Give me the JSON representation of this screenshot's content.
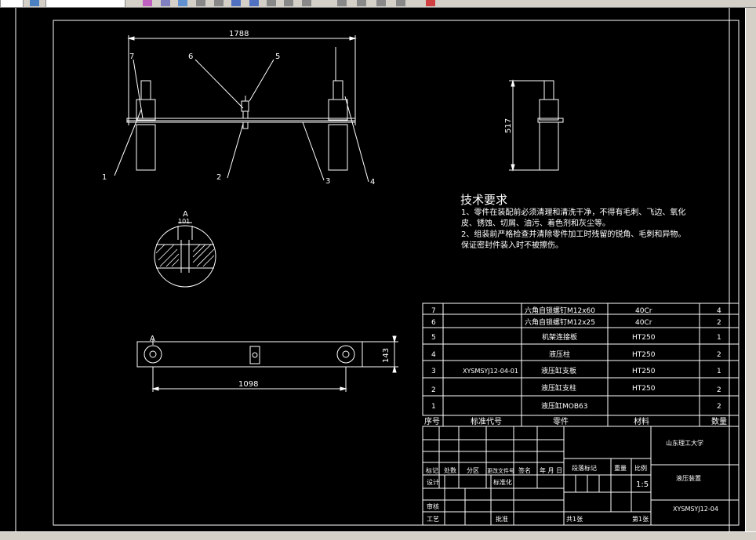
{
  "dimensions": {
    "top_width": "1788",
    "height": "517",
    "section_label": "A",
    "section_value": "101",
    "bottom_width": "1098",
    "bottom_height": "143",
    "view_label": "A"
  },
  "balloons": [
    "1",
    "2",
    "3",
    "4",
    "5",
    "6",
    "7"
  ],
  "tech": {
    "title": "技术要求",
    "line1": "1、零件在装配前必须清理和清洗干净，不得有毛刺、飞边、氧化",
    "line2": "皮、锈蚀、切屑、油污、着色剂和灰尘等。",
    "line3": "2、组装前严格检查并清除零件加工时残留的锐角、毛刺和异物。",
    "line4": "保证密封件装入时不被擦伤。"
  },
  "bom": {
    "rows": [
      {
        "no": "7",
        "code": "",
        "name": "六角自锁螺钉M12x60",
        "material": "40Cr",
        "qty": "4"
      },
      {
        "no": "6",
        "code": "",
        "name": "六角自锁螺钉M12x25",
        "material": "40Cr",
        "qty": "2"
      },
      {
        "no": "5",
        "code": "",
        "name": "机架连接板",
        "material": "HT250",
        "qty": "1"
      },
      {
        "no": "4",
        "code": "",
        "name": "液压柱",
        "material": "HT250",
        "qty": "2"
      },
      {
        "no": "3",
        "code": "XYSMSYJ12-04-01",
        "name": "液压缸支板",
        "material": "HT250",
        "qty": "1"
      },
      {
        "no": "2",
        "code": "",
        "name": "液压缸支柱",
        "material": "HT250",
        "qty": "2"
      },
      {
        "no": "1",
        "code": "",
        "name": "液压缸MOB63",
        "material": "",
        "qty": "2"
      }
    ],
    "header": {
      "no": "序号",
      "code": "标准代号",
      "name": "零件",
      "material": "材料",
      "qty": "数量"
    }
  },
  "title_block": {
    "university": "山东理工大学",
    "drawing_name": "液压装置",
    "drawing_code": "XYSMSYJ12-04",
    "stage_mark": "段落标记",
    "weight": "重量",
    "scale_label": "比例",
    "scale": "1:5",
    "sheets_total": "共1张",
    "sheet_no": "第1张",
    "row_labels": [
      "标记",
      "处数",
      "分区",
      "更改文件号",
      "签名",
      "年 月 日"
    ],
    "design": "设计",
    "standardize": "标准化",
    "review": "审核",
    "process": "工艺",
    "approve": "批准"
  }
}
